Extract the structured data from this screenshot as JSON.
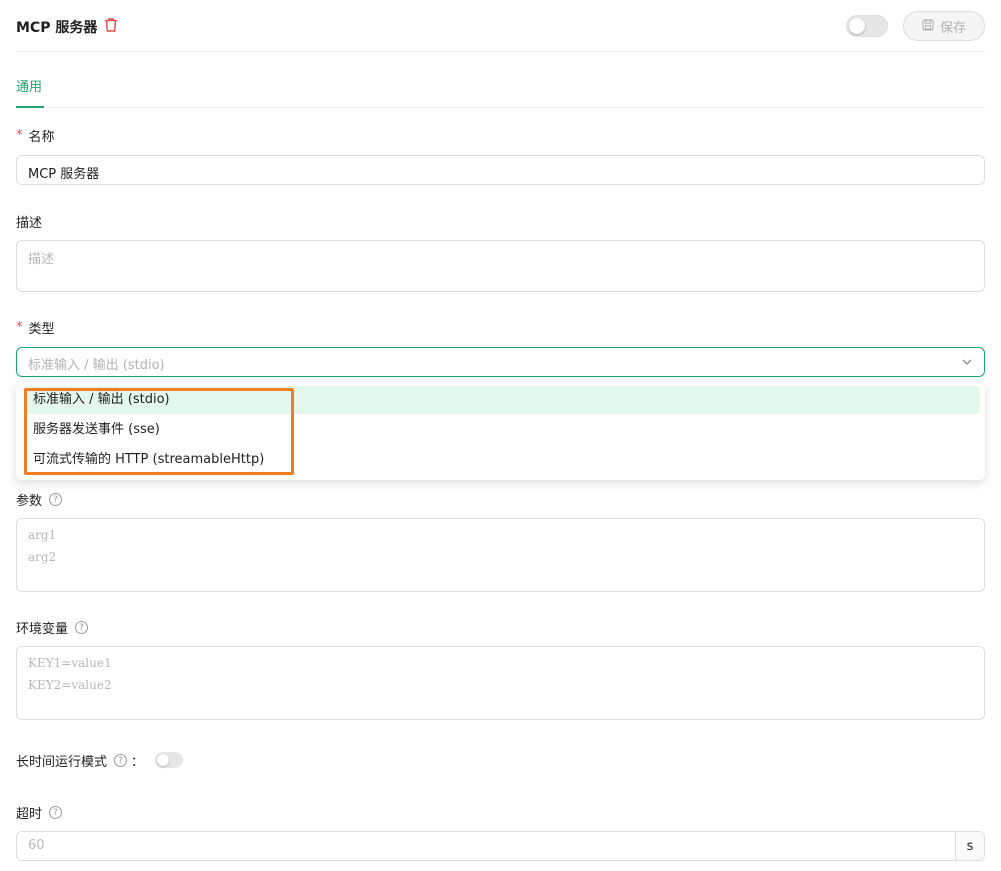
{
  "header": {
    "title": "MCP 服务器",
    "save_label": "保存",
    "enabled": false
  },
  "tabs": [
    {
      "label": "通用",
      "active": true
    }
  ],
  "form": {
    "name": {
      "label": "名称",
      "value": "MCP 服务器",
      "required": true
    },
    "description": {
      "label": "描述",
      "placeholder": "描述"
    },
    "type": {
      "label": "类型",
      "required": true,
      "placeholder": "标准输入 / 输出 (stdio)",
      "options": [
        {
          "label": "标准输入 / 输出 (stdio)",
          "selected": true
        },
        {
          "label": "服务器发送事件 (sse)",
          "selected": false
        },
        {
          "label": "可流式传输的 HTTP (streamableHttp)",
          "selected": false
        }
      ]
    },
    "args": {
      "label": "参数",
      "placeholder_lines": [
        "arg1",
        "arg2"
      ]
    },
    "env": {
      "label": "环境变量",
      "placeholder_lines": [
        "KEY1=value1",
        "KEY2=value2"
      ]
    },
    "long_running": {
      "label": "长时间运行模式",
      "colon": "：",
      "enabled": false
    },
    "timeout": {
      "label": "超时",
      "placeholder": "60",
      "suffix": "s"
    }
  },
  "colors": {
    "accent": "#1da46c",
    "danger": "#e5484d",
    "highlight": "#f07d22",
    "selected_bg": "#e3f7ec"
  },
  "icons": {
    "delete": "trash-icon",
    "save": "floppy-disk-icon",
    "chevron": "chevron-down-icon",
    "help": "question-circle-icon"
  }
}
